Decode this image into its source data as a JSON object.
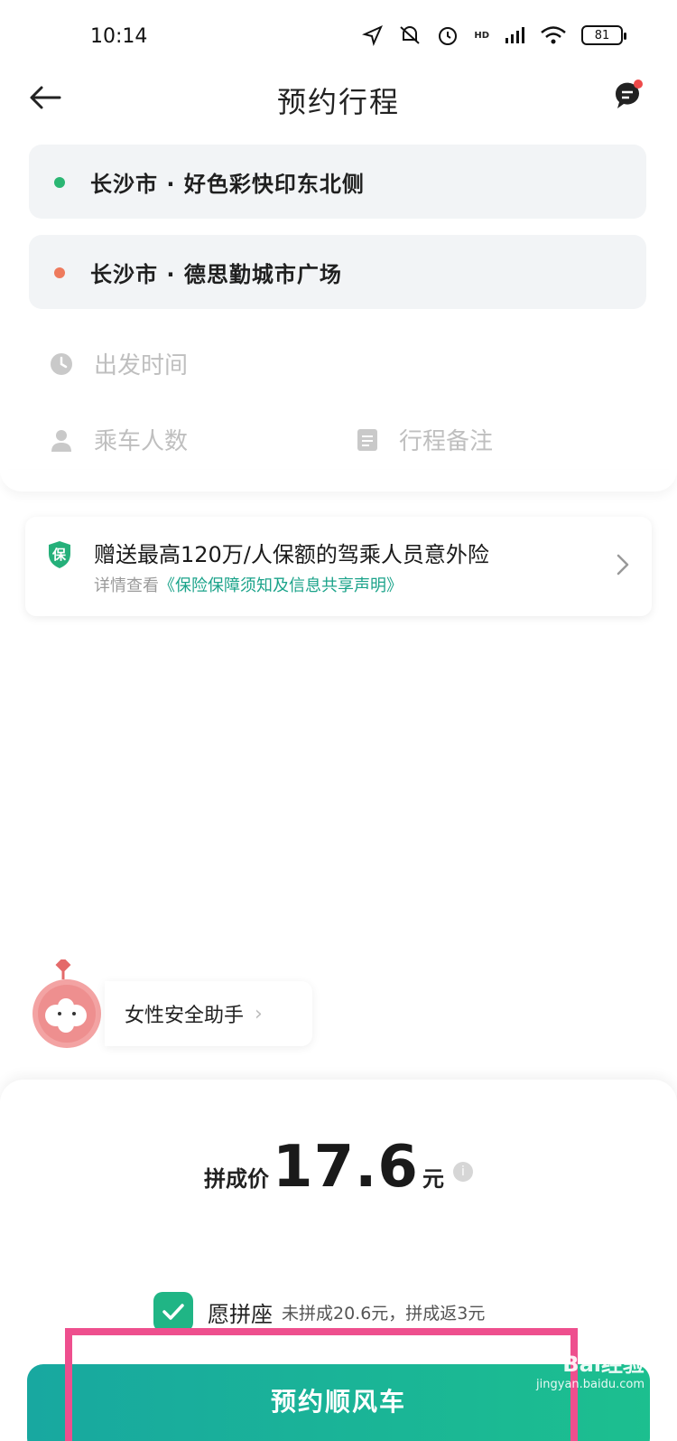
{
  "status_bar": {
    "time": "10:14",
    "battery": "81",
    "network_badge": "HD"
  },
  "nav": {
    "title": "预约行程"
  },
  "route": {
    "from": "长沙市 · 好色彩快印东北侧",
    "to": "长沙市 · 德思勤城市广场",
    "from_dot_color": "#2bb673",
    "to_dot_color": "#ee7a5d"
  },
  "options": {
    "time_placeholder": "出发时间",
    "passengers_placeholder": "乘车人数",
    "note_placeholder": "行程备注"
  },
  "insurance": {
    "badge": "保",
    "title": "赠送最高120万/人保额的驾乘人员意外险",
    "sub_prefix": "详情查看",
    "sub_link": "《保险保障须知及信息共享声明》"
  },
  "assistant": {
    "label": "女性安全助手"
  },
  "price": {
    "label": "拼成价",
    "value": "17.6",
    "unit": "元"
  },
  "carpool": {
    "checked": true,
    "label": "愿拼座",
    "note": "未拼成20.6元，拼成返3元"
  },
  "cta": {
    "label": "预约顺风车"
  },
  "watermark": {
    "brand": "Bai经验",
    "url": "jingyan.baidu.com"
  },
  "colors": {
    "accent": "#20b585",
    "highlight": "#ee4f8e"
  }
}
